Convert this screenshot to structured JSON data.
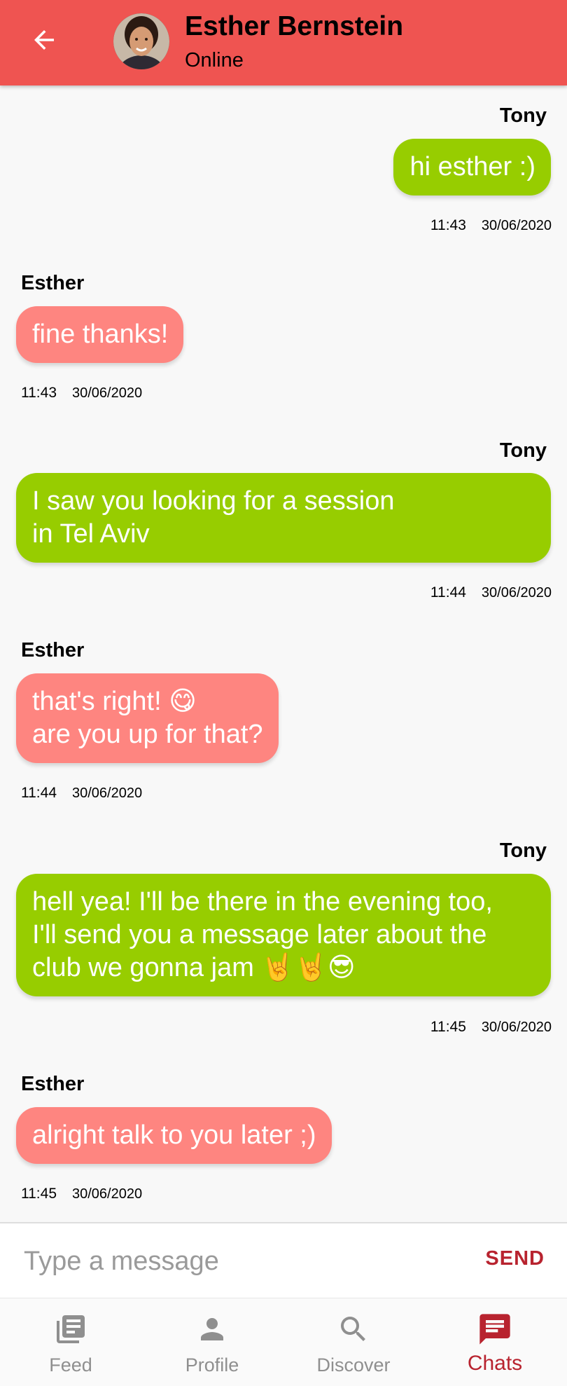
{
  "header": {
    "contact_name": "Esther Bernstein",
    "status": "Online",
    "colors": {
      "bar": "#ef5451"
    }
  },
  "messages": [
    {
      "sender": "Tony",
      "text": "hi esther :)",
      "time": "11:43",
      "date": "30/06/2020"
    },
    {
      "sender": "Esther",
      "text": "fine thanks!",
      "time": "11:43",
      "date": "30/06/2020"
    },
    {
      "sender": "Tony",
      "text": "I saw you looking for a session\nin Tel Aviv",
      "time": "11:44",
      "date": "30/06/2020"
    },
    {
      "sender": "Esther",
      "text": "that's right! 😋\nare you up for that?",
      "time": "11:44",
      "date": "30/06/2020"
    },
    {
      "sender": "Tony",
      "text": "hell yea! I'll be there in the evening too,\nI'll send you a message later about the\nclub we gonna jam 🤘🤘😎",
      "time": "11:45",
      "date": "30/06/2020"
    },
    {
      "sender": "Esther",
      "text": "alright talk to you later ;)",
      "time": "11:45",
      "date": "30/06/2020"
    }
  ],
  "composer": {
    "placeholder": "Type a message",
    "value": "",
    "send_label": "SEND"
  },
  "nav": {
    "items": [
      {
        "label": "Feed",
        "icon": "feed-icon"
      },
      {
        "label": "Profile",
        "icon": "person-icon"
      },
      {
        "label": "Discover",
        "icon": "search-icon"
      },
      {
        "label": "Chats",
        "icon": "chat-icon",
        "active": true
      }
    ]
  },
  "colors": {
    "tony_bubble": "#97cd00",
    "esther_bubble": "#fe8580",
    "accent": "#b8232f"
  }
}
